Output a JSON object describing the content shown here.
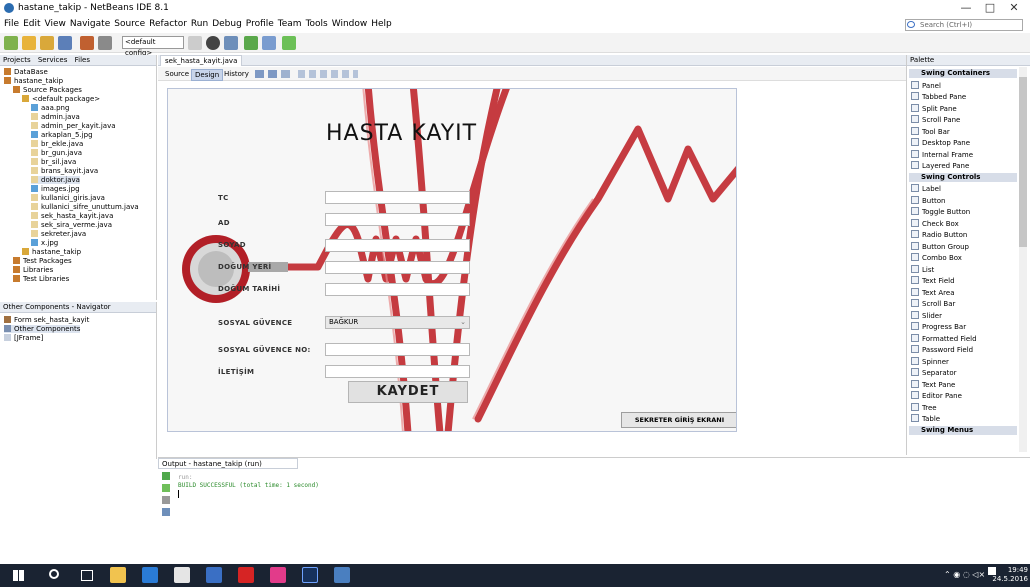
{
  "window": {
    "title": "hastane_takip - NetBeans IDE 8.1",
    "min": "—",
    "max": "□",
    "close": "✕"
  },
  "menu": [
    "File",
    "Edit",
    "View",
    "Navigate",
    "Source",
    "Refactor",
    "Run",
    "Debug",
    "Profile",
    "Team",
    "Tools",
    "Window",
    "Help"
  ],
  "search": {
    "placeholder": "Search (Ctrl+I)"
  },
  "toolbar": {
    "config": "<default config>"
  },
  "projects": {
    "tabs": [
      "Projects",
      "Services",
      "Files"
    ],
    "items": [
      {
        "label": "DataBase",
        "level": 0
      },
      {
        "label": "hastane_takip",
        "level": 0
      },
      {
        "label": "Source Packages",
        "level": 1
      },
      {
        "label": "<default package>",
        "level": 2
      },
      {
        "label": "aaa.png",
        "level": 3
      },
      {
        "label": "admin.java",
        "level": 3
      },
      {
        "label": "admin_per_kayit.java",
        "level": 3
      },
      {
        "label": "arkaplan_5.jpg",
        "level": 3
      },
      {
        "label": "br_ekle.java",
        "level": 3
      },
      {
        "label": "br_gun.java",
        "level": 3
      },
      {
        "label": "br_sil.java",
        "level": 3
      },
      {
        "label": "brans_kayit.java",
        "level": 3
      },
      {
        "label": "doktor.java",
        "level": 3
      },
      {
        "label": "images.jpg",
        "level": 3
      },
      {
        "label": "kullanici_giris.java",
        "level": 3
      },
      {
        "label": "kullanici_sifre_unuttum.java",
        "level": 3
      },
      {
        "label": "sek_hasta_kayit.java",
        "level": 3
      },
      {
        "label": "sek_sira_verme.java",
        "level": 3
      },
      {
        "label": "sekreter.java",
        "level": 3
      },
      {
        "label": "x.jpg",
        "level": 3
      },
      {
        "label": "hastane_takip",
        "level": 2
      },
      {
        "label": "Test Packages",
        "level": 1
      },
      {
        "label": "Libraries",
        "level": 1
      },
      {
        "label": "Test Libraries",
        "level": 1
      }
    ]
  },
  "navigator": {
    "title": "Other Components - Navigator",
    "items": [
      {
        "label": "Form sek_hasta_kayit",
        "level": 0
      },
      {
        "label": "Other Components",
        "level": 0
      },
      {
        "label": "[JFrame]",
        "level": 0
      }
    ]
  },
  "editor": {
    "tab": "sek_hasta_kayit.java",
    "subtabs": [
      "Source",
      "Design",
      "History"
    ],
    "form": {
      "title": "HASTA KAYIT",
      "labels": [
        "TC",
        "AD",
        "SOYAD",
        "DOĞUM YERİ",
        "DOĞUM TARİHİ",
        "SOSYAL GÜVENCE",
        "SOSYAL GÜVENCE NO:",
        "İLETİŞİM"
      ],
      "combo_value": "BAĞKUR",
      "save_button": "KAYDET",
      "secretary_button": "SEKRETER GİRİŞ EKRANI"
    }
  },
  "palette": {
    "title": "Palette",
    "entries": [
      {
        "label": "Swing Containers",
        "cat": true
      },
      {
        "label": "Panel"
      },
      {
        "label": "Tabbed Pane"
      },
      {
        "label": "Split Pane"
      },
      {
        "label": "Scroll Pane"
      },
      {
        "label": "Tool Bar"
      },
      {
        "label": "Desktop Pane"
      },
      {
        "label": "Internal Frame"
      },
      {
        "label": "Layered Pane"
      },
      {
        "label": "Swing Controls",
        "cat": true
      },
      {
        "label": "Label"
      },
      {
        "label": "Button"
      },
      {
        "label": "Toggle Button"
      },
      {
        "label": "Check Box"
      },
      {
        "label": "Radio Button"
      },
      {
        "label": "Button Group"
      },
      {
        "label": "Combo Box"
      },
      {
        "label": "List"
      },
      {
        "label": "Text Field"
      },
      {
        "label": "Text Area"
      },
      {
        "label": "Scroll Bar"
      },
      {
        "label": "Slider"
      },
      {
        "label": "Progress Bar"
      },
      {
        "label": "Formatted Field"
      },
      {
        "label": "Password Field"
      },
      {
        "label": "Spinner"
      },
      {
        "label": "Separator"
      },
      {
        "label": "Text Pane"
      },
      {
        "label": "Editor Pane"
      },
      {
        "label": "Tree"
      },
      {
        "label": "Table"
      },
      {
        "label": "Swing Menus",
        "cat": true
      }
    ]
  },
  "output": {
    "tab": "Output - hastane_takip (run)",
    "lines": [
      "run:",
      "BUILD SUCCESSFUL (total time: 1 second)"
    ]
  },
  "taskbar": {
    "time": "19:49",
    "date": "24.5.2016"
  },
  "colors": {
    "accent": "#c0272d",
    "panel_head": "#e8ecf2",
    "taskbar": "#1a2332"
  }
}
